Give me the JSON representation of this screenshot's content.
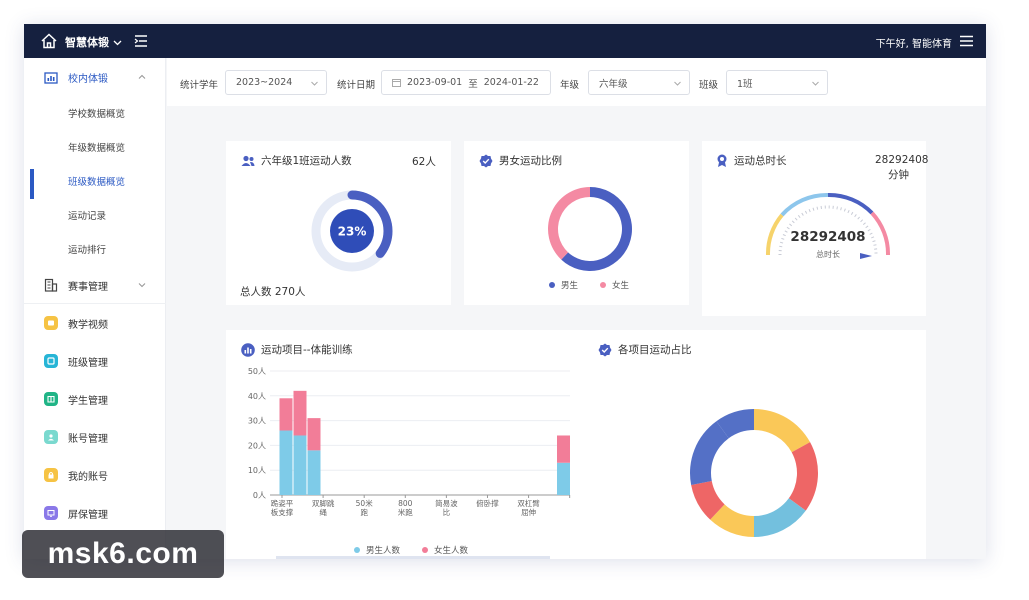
{
  "topbar": {
    "brand": "智慧体锻",
    "greeting": "下午好, 智能体育"
  },
  "sidebar": {
    "group1": {
      "label": "校内体锻",
      "icon": "building-chart-icon"
    },
    "sub_items": [
      {
        "label": "学校数据概览",
        "active": false
      },
      {
        "label": "年级数据概览",
        "active": false
      },
      {
        "label": "班级数据概览",
        "active": true
      },
      {
        "label": "运动记录",
        "active": false
      },
      {
        "label": "运动排行",
        "active": false
      }
    ],
    "group2": {
      "label": "赛事管理",
      "icon": "building-icon"
    },
    "items": [
      {
        "label": "教学视频",
        "icon": "video-icon",
        "color": "#f6c344"
      },
      {
        "label": "班级管理",
        "icon": "class-icon",
        "color": "#27b5d6"
      },
      {
        "label": "学生管理",
        "icon": "student-icon",
        "color": "#20b486"
      },
      {
        "label": "账号管理",
        "icon": "account-icon",
        "color": "#6ad7cc"
      },
      {
        "label": "我的账号",
        "icon": "lock-icon",
        "color": "#f6c344"
      },
      {
        "label": "屏保管理",
        "icon": "screen-icon",
        "color": "#8a78e8"
      }
    ]
  },
  "filters": {
    "year_label": "统计学年",
    "year_value": "2023~2024",
    "date_label": "统计日期",
    "date_start": "2023-09-01",
    "date_sep": "至",
    "date_end": "2024-01-22",
    "grade_label": "年级",
    "grade_value": "六年级",
    "class_label": "班级",
    "class_value": "1班"
  },
  "card_active": {
    "title": "六年级1班运动人数",
    "count": "62人",
    "percent_label": "23%",
    "percent": 0.23,
    "total": "总人数 270人"
  },
  "card_gender": {
    "title": "男女运动比例",
    "legend": [
      "男生",
      "女生"
    ],
    "male_ratio": 0.62,
    "colors": {
      "male": "#4a5fc1",
      "female": "#f48aa3"
    }
  },
  "card_duration": {
    "title": "运动总时长",
    "value": "28292408",
    "unit": "分钟",
    "gauge_value": "28292408",
    "gauge_label": "总时长"
  },
  "card_project": {
    "title": "运动项目--体能训练",
    "legend": [
      "男生人数",
      "女生人数"
    ],
    "colors": {
      "male": "#7ecbe8",
      "female": "#f27d98"
    }
  },
  "card_share": {
    "title": "各项目运动占比",
    "colors": [
      "#f6c344",
      "#ee6666",
      "#73c0de",
      "#fac858",
      "#ee6a6a",
      "#4d6ac6"
    ]
  },
  "chart_data": [
    {
      "type": "bar",
      "title": "运动项目--体能训练",
      "categories": [
        "跪姿平板支撑",
        "双脚跳绳",
        "50米跑",
        "800米跑",
        "简易波比",
        "俯卧撑",
        "双杠臂屈伸",
        ""
      ],
      "category_lines": [
        [
          "跪姿平",
          "板支撑"
        ],
        [
          "双脚跳",
          "绳"
        ],
        [
          "50米",
          "跑"
        ],
        [
          "800",
          "米跑"
        ],
        [
          "简易波",
          "比"
        ],
        [
          "俯卧撑",
          ""
        ],
        [
          "双杠臂",
          "屈伸"
        ],
        [
          "",
          ""
        ]
      ],
      "series": [
        {
          "name": "男生人数",
          "stack": [
            [
              26,
              24,
              18
            ],
            [],
            [],
            [],
            [],
            [],
            [],
            [
              13
            ]
          ]
        },
        {
          "name": "女生人数",
          "stack": [
            [
              13,
              18,
              13
            ],
            [],
            [],
            [],
            [],
            [],
            [],
            [
              11
            ]
          ]
        }
      ],
      "ylim": [
        0,
        50
      ],
      "yticks": [
        "0人",
        "10人",
        "20人",
        "30人",
        "40人",
        "50人"
      ],
      "legend": [
        "男生人数",
        "女生人数"
      ]
    },
    {
      "type": "pie",
      "title": "各项目运动占比",
      "values": [
        17,
        18,
        15,
        12,
        10,
        18,
        10
      ],
      "colors": [
        "#fac858",
        "#ee6666",
        "#73c0de",
        "#fac858",
        "#ee6666",
        "#5470c6",
        "#5470c6"
      ]
    },
    {
      "type": "pie",
      "title": "男女运动比例",
      "labels": [
        "男生",
        "女生"
      ],
      "values": [
        62,
        38
      ]
    }
  ],
  "watermark": "msk6.com"
}
